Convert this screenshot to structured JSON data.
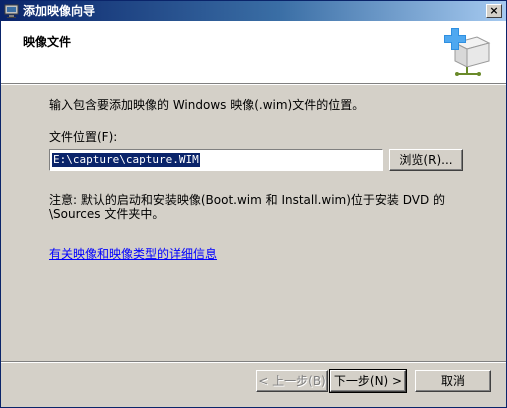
{
  "window": {
    "title": "添加映像向导",
    "close_label": "×"
  },
  "header": {
    "title": "映像文件"
  },
  "main": {
    "description": "输入包含要添加映像的 Windows 映像(.wim)文件的位置。",
    "location_label": "文件位置(F):",
    "location_value": "E:\\capture\\capture.WIM",
    "browse_label": "浏览(R)...",
    "note_line1": "注意: 默认的启动和安装映像(Boot.wim 和 Install.wim)位于安装 DVD 的",
    "note_line2": "\\Sources 文件夹中。",
    "link_text": "有关映像和映像类型的详细信息"
  },
  "footer": {
    "back_label": "< 上一步(B)",
    "next_label": "下一步(N) >",
    "cancel_label": "取消"
  },
  "icons": {
    "app": "wizard-app-icon",
    "header": "add-image-box-icon"
  },
  "colors": {
    "titlebar_start": "#0a246a",
    "titlebar_end": "#a6caf0",
    "dialog_bg": "#d4d0c8",
    "link": "#0000ff",
    "selection": "#0a246a"
  }
}
